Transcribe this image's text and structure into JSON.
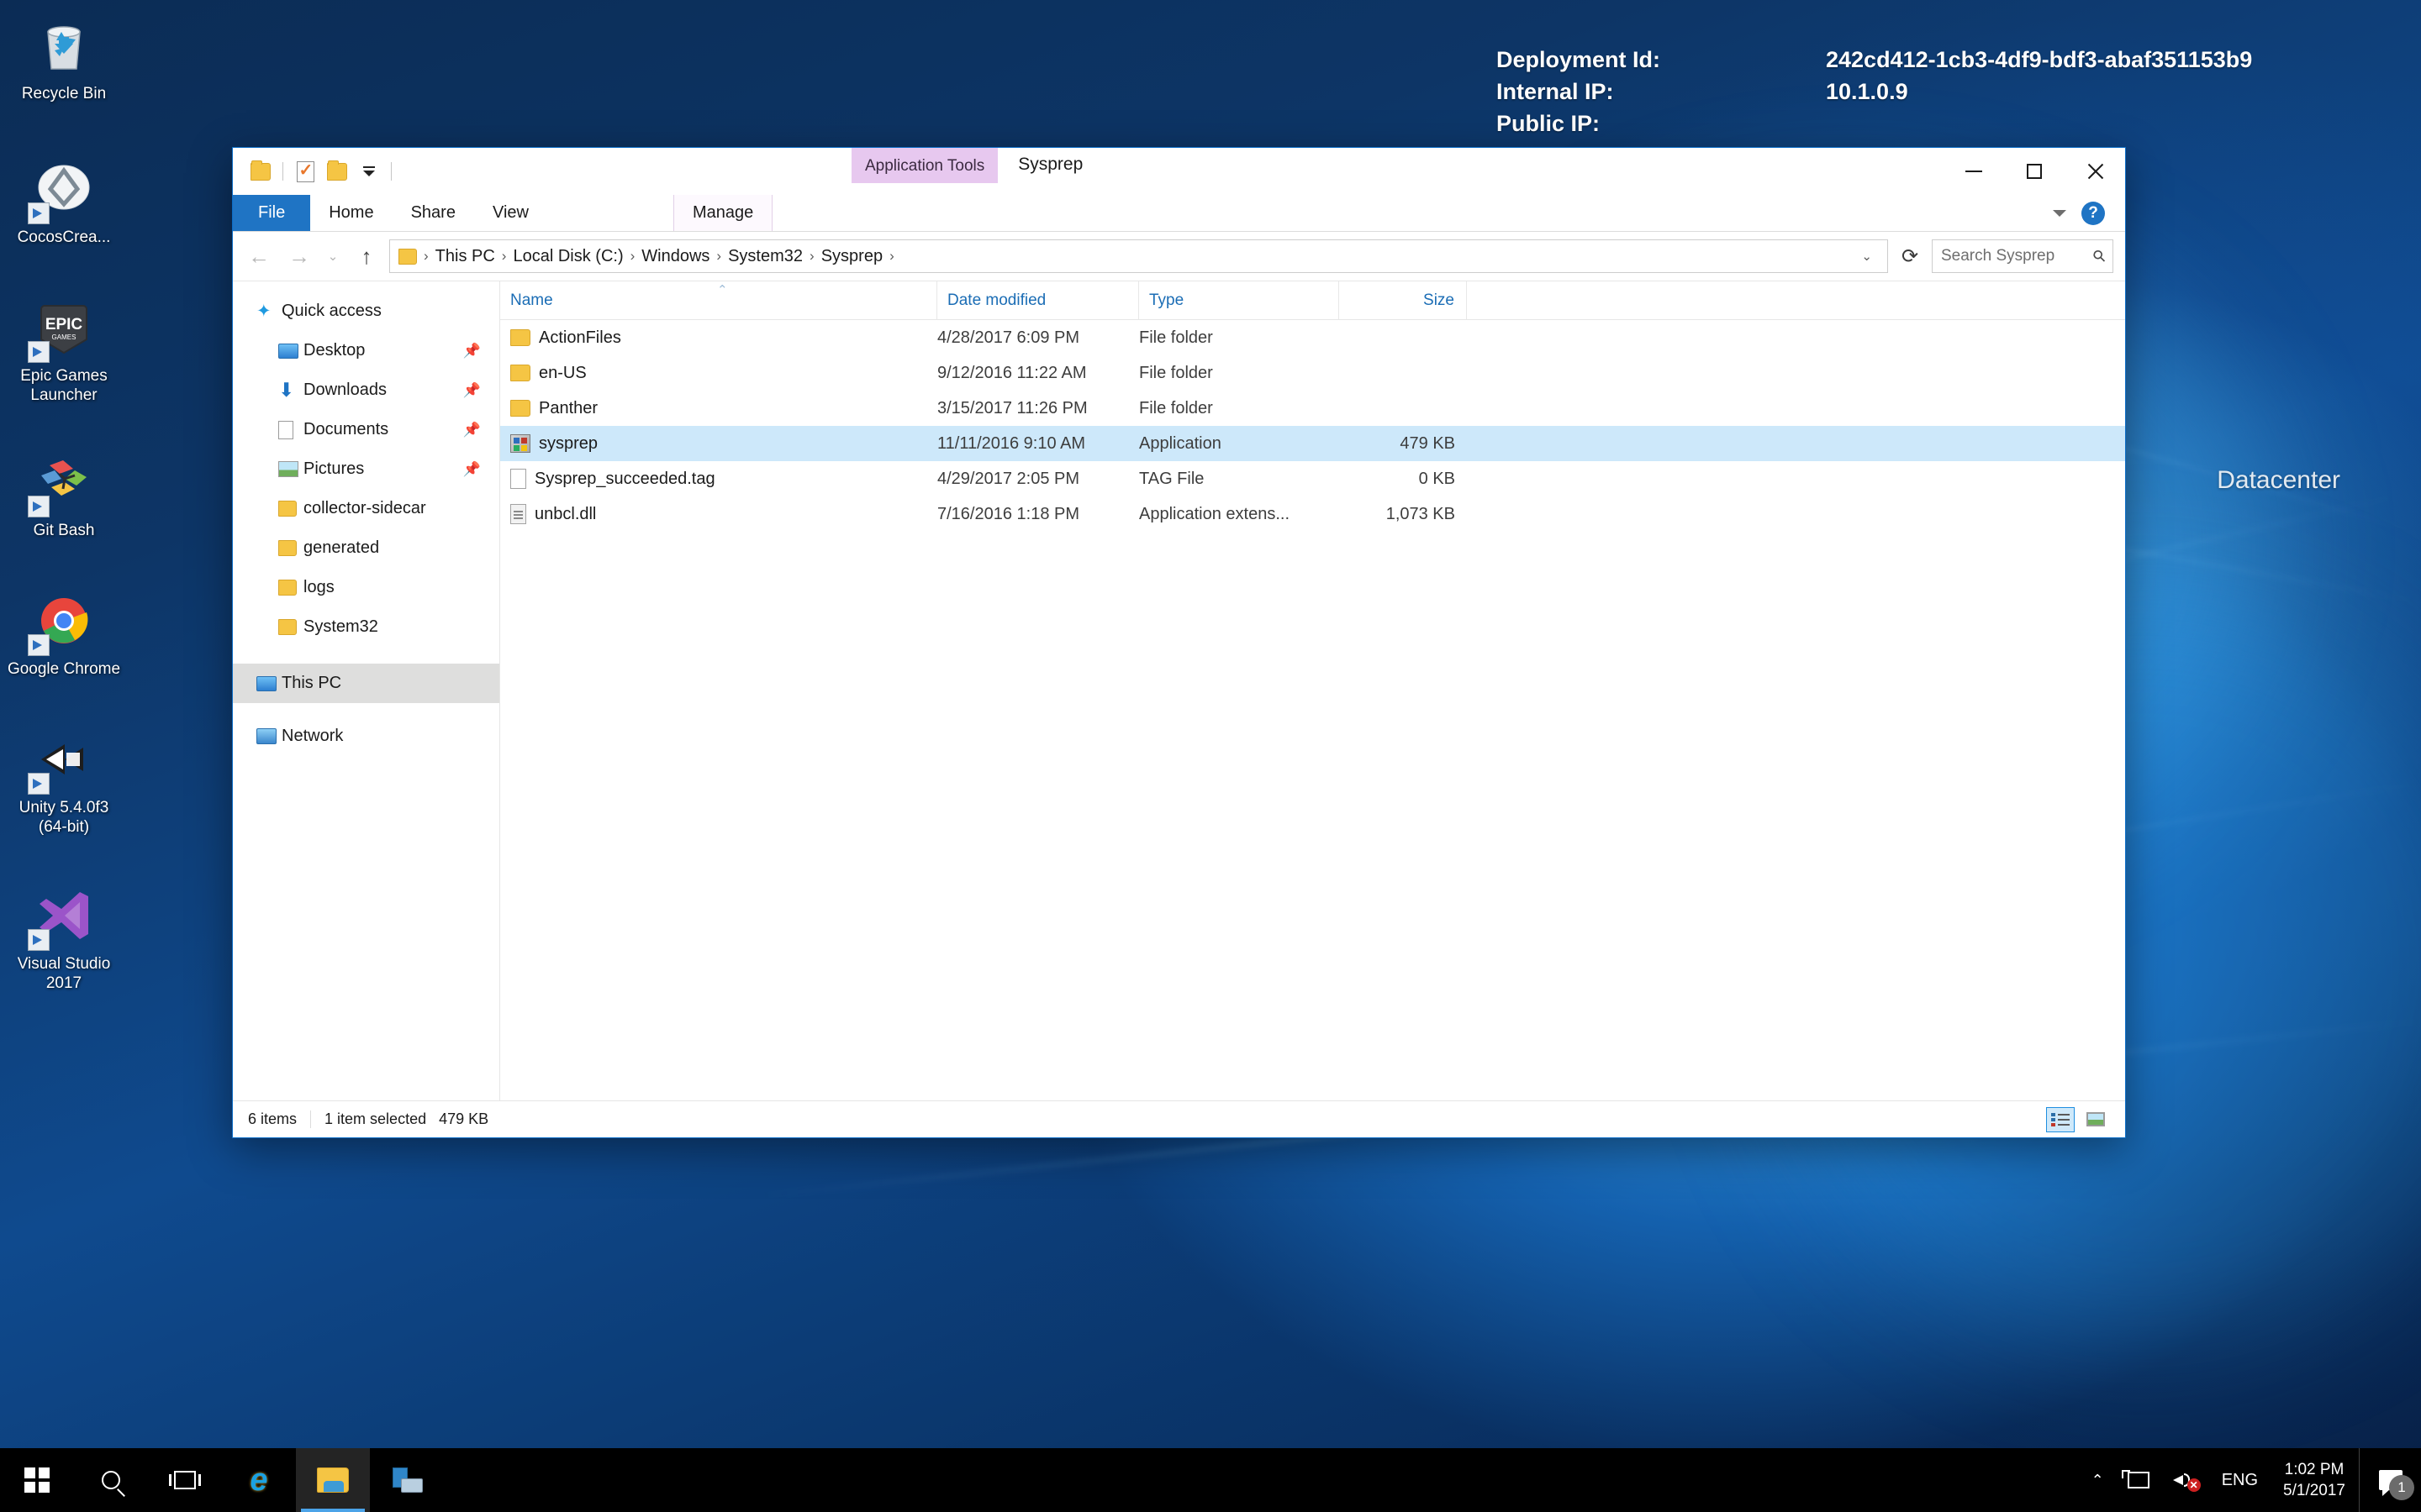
{
  "deployment": {
    "rows": [
      {
        "label": "Deployment Id:",
        "value": "242cd412-1cb3-4df9-bdf3-abaf351153b9"
      },
      {
        "label": "Internal IP:",
        "value": "10.1.0.9"
      },
      {
        "label": "Public IP:",
        "value": ""
      }
    ]
  },
  "watermark": {
    "line1": "Datacenter"
  },
  "desktop": {
    "icons": [
      {
        "label": "Recycle Bin",
        "icon": "recycle-bin-icon",
        "shortcut": false
      },
      {
        "label": "CocosCrea...",
        "icon": "cocos-creator-icon",
        "shortcut": true
      },
      {
        "label": "Epic Games Launcher",
        "icon": "epic-games-icon",
        "shortcut": true
      },
      {
        "label": "Git Bash",
        "icon": "git-bash-icon",
        "shortcut": true
      },
      {
        "label": "Google Chrome",
        "icon": "chrome-icon",
        "shortcut": true
      },
      {
        "label": "Unity 5.4.0f3 (64-bit)",
        "icon": "unity-icon",
        "shortcut": true
      },
      {
        "label": "Visual Studio 2017",
        "icon": "visual-studio-icon",
        "shortcut": true
      }
    ]
  },
  "explorer": {
    "title": "Sysprep",
    "contextual_tab_title": "Application Tools",
    "quick_access_toolbar": [
      {
        "name": "properties-button",
        "icon": "folder-icon"
      },
      {
        "name": "new-folder-button",
        "icon": "doc-check-icon"
      },
      {
        "name": "customize-qat-button",
        "icon": "chevron-down-icon"
      }
    ],
    "window_controls": {
      "minimize": "Minimize",
      "maximize": "Maximize",
      "close": "Close"
    },
    "ribbon_tabs": [
      {
        "label": "File",
        "kind": "file"
      },
      {
        "label": "Home",
        "kind": "normal"
      },
      {
        "label": "Share",
        "kind": "normal"
      },
      {
        "label": "View",
        "kind": "normal"
      },
      {
        "label": "Manage",
        "kind": "contextual"
      }
    ],
    "ribbon_help_label": "?",
    "nav": {
      "back": "←",
      "forward": "→",
      "recent": "⌄",
      "up": "↑",
      "refresh": "⟳",
      "dropdown": "⌄"
    },
    "breadcrumb": [
      "This PC",
      "Local Disk (C:)",
      "Windows",
      "System32",
      "Sysprep"
    ],
    "search": {
      "placeholder": "Search Sysprep",
      "value": ""
    },
    "nav_pane": [
      {
        "label": "Quick access",
        "icon": "star-icon",
        "level": 0,
        "pinned": false,
        "selected": false
      },
      {
        "label": "Desktop",
        "icon": "desktop-icon",
        "level": 1,
        "pinned": true,
        "selected": false
      },
      {
        "label": "Downloads",
        "icon": "downloads-icon",
        "level": 1,
        "pinned": true,
        "selected": false
      },
      {
        "label": "Documents",
        "icon": "documents-icon",
        "level": 1,
        "pinned": true,
        "selected": false
      },
      {
        "label": "Pictures",
        "icon": "pictures-icon",
        "level": 1,
        "pinned": true,
        "selected": false
      },
      {
        "label": "collector-sidecar",
        "icon": "folder-icon",
        "level": 1,
        "pinned": false,
        "selected": false
      },
      {
        "label": "generated",
        "icon": "folder-icon",
        "level": 1,
        "pinned": false,
        "selected": false
      },
      {
        "label": "logs",
        "icon": "folder-icon",
        "level": 1,
        "pinned": false,
        "selected": false
      },
      {
        "label": "System32",
        "icon": "folder-icon",
        "level": 1,
        "pinned": false,
        "selected": false
      },
      {
        "label": "This PC",
        "icon": "this-pc-icon",
        "level": 0,
        "pinned": false,
        "selected": true
      },
      {
        "label": "Network",
        "icon": "network-icon",
        "level": 0,
        "pinned": false,
        "selected": false
      }
    ],
    "columns": {
      "name": "Name",
      "date_modified": "Date modified",
      "type": "Type",
      "size": "Size",
      "sort_indicator": "⌃"
    },
    "files": [
      {
        "name": "ActionFiles",
        "date": "4/28/2017 6:09 PM",
        "type": "File folder",
        "size": "",
        "icon": "folder",
        "selected": false
      },
      {
        "name": "en-US",
        "date": "9/12/2016 11:22 AM",
        "type": "File folder",
        "size": "",
        "icon": "folder",
        "selected": false
      },
      {
        "name": "Panther",
        "date": "3/15/2017 11:26 PM",
        "type": "File folder",
        "size": "",
        "icon": "folder",
        "selected": false
      },
      {
        "name": "sysprep",
        "date": "11/11/2016 9:10 AM",
        "type": "Application",
        "size": "479 KB",
        "icon": "app",
        "selected": true
      },
      {
        "name": "Sysprep_succeeded.tag",
        "date": "4/29/2017 2:05 PM",
        "type": "TAG File",
        "size": "0 KB",
        "icon": "tag",
        "selected": false
      },
      {
        "name": "unbcl.dll",
        "date": "7/16/2016 1:18 PM",
        "type": "Application extens...",
        "size": "1,073 KB",
        "icon": "dll",
        "selected": false
      }
    ],
    "status": {
      "item_count": "6 items",
      "selection": "1 item selected",
      "selection_size": "479 KB"
    },
    "view_toggles": [
      {
        "name": "details-view-button",
        "active": true
      },
      {
        "name": "large-icons-view-button",
        "active": false
      }
    ]
  },
  "taskbar": {
    "buttons": [
      {
        "name": "start-button",
        "icon": "windows-logo-icon",
        "active": false
      },
      {
        "name": "search-button",
        "icon": "search-icon",
        "active": false
      },
      {
        "name": "task-view-button",
        "icon": "task-view-icon",
        "active": false
      },
      {
        "name": "internet-explorer-button",
        "icon": "internet-explorer-icon",
        "active": false
      },
      {
        "name": "file-explorer-button",
        "icon": "file-explorer-icon",
        "active": true
      },
      {
        "name": "server-manager-button",
        "icon": "server-manager-icon",
        "active": false
      }
    ],
    "tray": {
      "show_hidden": "⌃",
      "language": "ENG",
      "time": "1:02 PM",
      "date": "5/1/2017",
      "notification_count": "1",
      "mute_mark": "✕"
    }
  },
  "colors": {
    "accent": "#1f74c4",
    "selection": "#cde8fa",
    "contextual_tab": "#e7c8ef",
    "folder_yellow": "#f5c544",
    "taskbar": "#000000"
  }
}
